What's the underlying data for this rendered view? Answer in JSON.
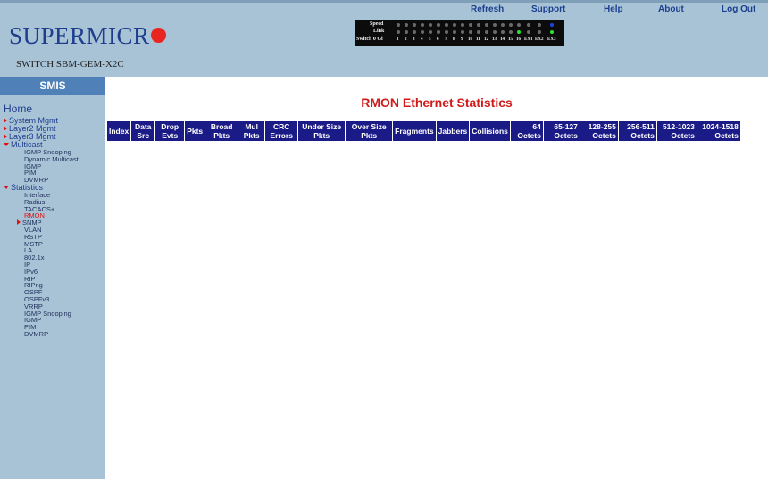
{
  "header": {
    "brand": "SUPERMICR",
    "switch_name": "SWITCH SBM-GEM-X2C",
    "links": [
      "Refresh",
      "Support",
      "Help",
      "About",
      "Log Out"
    ],
    "led_panel": {
      "speed_label": "Speed",
      "link_label": "Link",
      "switch_label": "Switch 0 Gi",
      "ports": [
        "1",
        "2",
        "3",
        "4",
        "5",
        "6",
        "7",
        "8",
        "9",
        "10",
        "11",
        "12",
        "13",
        "14",
        "15",
        "16",
        "EX1",
        "EX2",
        "EX3"
      ]
    },
    "colors": {
      "bg": "#a9c3d6",
      "brand": "#1e3d8c",
      "logo_dot": "#e8261f"
    }
  },
  "sidebar": {
    "title": "SMIS",
    "home": "Home",
    "items": [
      {
        "label": "System Mgmt",
        "marker": "collapsed"
      },
      {
        "label": "Layer2 Mgmt",
        "marker": "collapsed"
      },
      {
        "label": "Layer3 Mgmt",
        "marker": "collapsed"
      },
      {
        "label": "Multicast",
        "marker": "expanded"
      },
      {
        "label": "IGMP Snooping",
        "sub": true
      },
      {
        "label": "Dynamic Multicast",
        "sub": true
      },
      {
        "label": "IGMP",
        "sub": true
      },
      {
        "label": "PIM",
        "sub": true
      },
      {
        "label": "DVMRP",
        "sub": true
      },
      {
        "label": "Statistics",
        "marker": "expanded"
      },
      {
        "label": "Interface",
        "sub": true
      },
      {
        "label": "Radius",
        "sub": true
      },
      {
        "label": "TACACS+",
        "sub": true
      },
      {
        "label": "RMON",
        "sub": true,
        "selected": true
      },
      {
        "label": "SNMP",
        "sub": true,
        "marker": "collapsed"
      },
      {
        "label": "VLAN",
        "sub": true
      },
      {
        "label": "RSTP",
        "sub": true
      },
      {
        "label": "MSTP",
        "sub": true
      },
      {
        "label": "LA",
        "sub": true
      },
      {
        "label": "802.1x",
        "sub": true
      },
      {
        "label": "IP",
        "sub": true
      },
      {
        "label": "IPv6",
        "sub": true
      },
      {
        "label": "RIP",
        "sub": true
      },
      {
        "label": "RIPng",
        "sub": true
      },
      {
        "label": "OSPF",
        "sub": true
      },
      {
        "label": "OSPFv3",
        "sub": true
      },
      {
        "label": "VRRP",
        "sub": true
      },
      {
        "label": "IGMP Snooping",
        "sub": true
      },
      {
        "label": "IGMP",
        "sub": true
      },
      {
        "label": "PIM",
        "sub": true
      },
      {
        "label": "DVMRP",
        "sub": true
      }
    ]
  },
  "main": {
    "title": "RMON Ethernet Statistics",
    "columns": [
      [
        "Index"
      ],
      [
        "Data",
        "Src"
      ],
      [
        "Drop",
        "Evts"
      ],
      [
        "Pkts"
      ],
      [
        "Broad",
        "Pkts"
      ],
      [
        "Mul",
        "Pkts"
      ],
      [
        "CRC",
        "Errors"
      ],
      [
        "Under Size",
        "Pkts"
      ],
      [
        "Over Size",
        "Pkts"
      ],
      [
        "Fragments"
      ],
      [
        "Jabbers"
      ],
      [
        "Collisions"
      ],
      [
        "64",
        "Octets"
      ],
      [
        "65-127",
        "Octets"
      ],
      [
        "128-255",
        "Octets"
      ],
      [
        "256-511",
        "Octets"
      ],
      [
        "512-1023",
        "Octets"
      ],
      [
        "1024-1518",
        "Octets"
      ]
    ],
    "colors": {
      "header_bg": "#1b1b87",
      "title": "#d11a1a"
    }
  }
}
